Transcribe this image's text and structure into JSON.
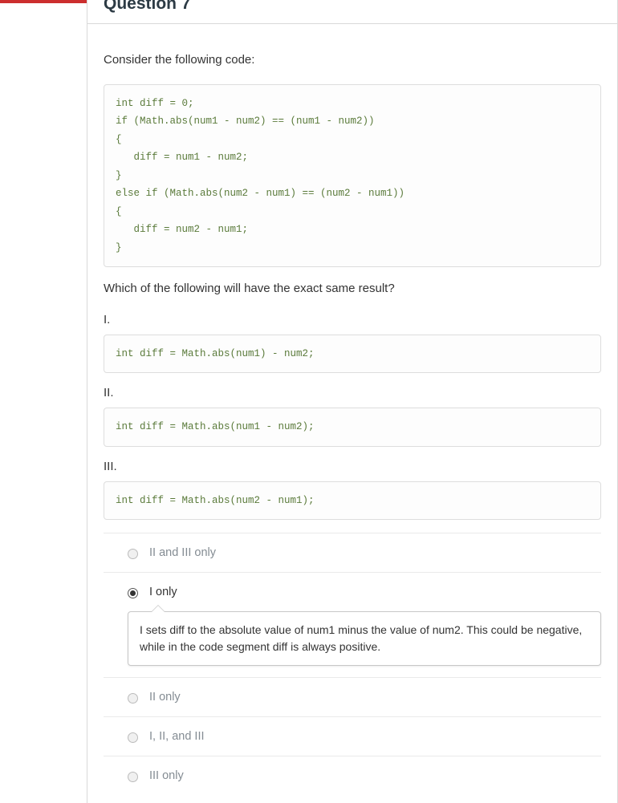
{
  "header": {
    "title": "Question 7"
  },
  "question": {
    "intro": "Consider the following code:",
    "code_main": "int diff = 0;\nif (Math.abs(num1 - num2) == (num1 - num2))\n{\n   diff = num1 - num2;\n}\nelse if (Math.abs(num2 - num1) == (num2 - num1))\n{\n   diff = num2 - num1;\n}",
    "prompt": "Which of the following will have the exact same result?",
    "alts": {
      "I": {
        "label": "I.",
        "code": "int diff = Math.abs(num1) - num2;"
      },
      "II": {
        "label": "II.",
        "code": "int diff = Math.abs(num1 - num2);"
      },
      "III": {
        "label": "III.",
        "code": "int diff = Math.abs(num2 - num1);"
      }
    }
  },
  "options": {
    "a": {
      "label": "II and III only"
    },
    "b": {
      "label": "I only",
      "feedback": "I sets diff to the absolute value of num1 minus the value of num2. This could be negative, while in the code segment diff is always positive."
    },
    "c": {
      "label": "II only"
    },
    "d": {
      "label": "I, II, and III"
    },
    "e": {
      "label": "III only"
    }
  }
}
